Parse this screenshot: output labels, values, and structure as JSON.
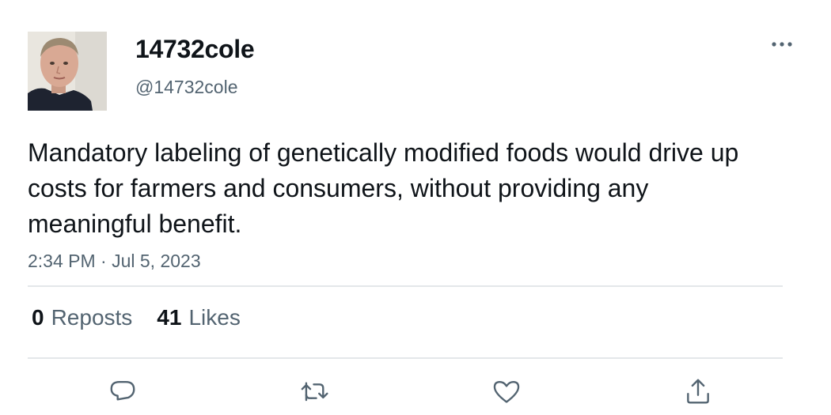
{
  "user": {
    "display_name": "14732cole",
    "handle": "@14732cole"
  },
  "tweet": {
    "text": "Mandatory labeling of genetically modified foods would drive up costs for farmers and consumers, without providing any meaningful benefit.",
    "timestamp": "2:34 PM · Jul 5, 2023"
  },
  "stats": {
    "reposts_count": "0",
    "reposts_label": "Reposts",
    "likes_count": "41",
    "likes_label": "Likes"
  },
  "icons": {
    "more": "more-horizontal-icon",
    "reply": "reply-icon",
    "retweet": "retweet-icon",
    "like": "heart-icon",
    "share": "share-icon"
  },
  "colors": {
    "text_primary": "#0f1419",
    "text_secondary": "#536471",
    "divider": "#e4e7ea"
  }
}
